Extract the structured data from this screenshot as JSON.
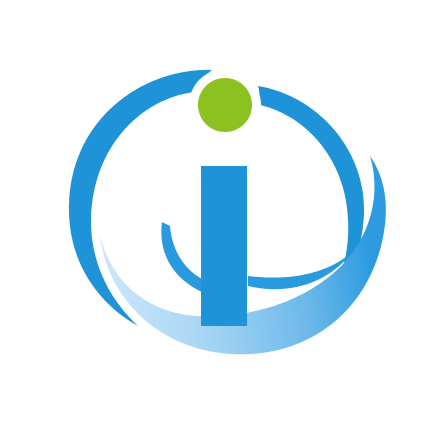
{
  "logo": {
    "icon": "info-i-logo-icon",
    "colors": {
      "background": "#ffffff",
      "primary_blue": "#1e90d6",
      "light_blue": "#9fd1f3",
      "dot_green": "#8cc21f"
    }
  }
}
